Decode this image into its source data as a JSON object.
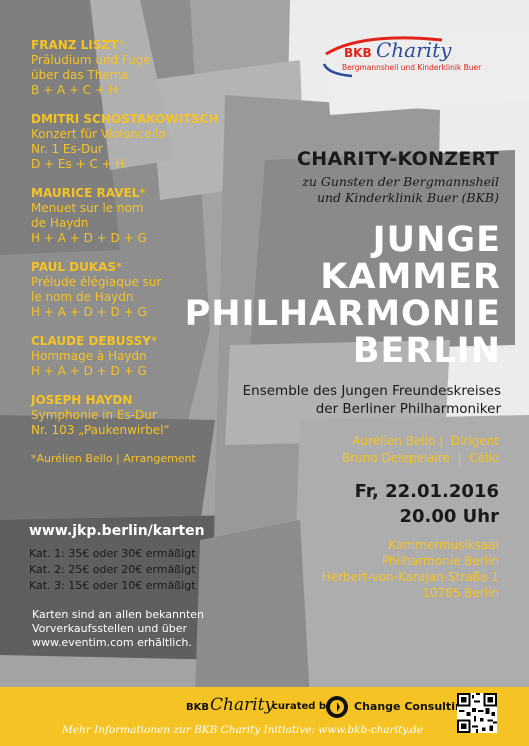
{
  "program": [
    {
      "composer": "FRANZ LISZT",
      "star": "*",
      "lines": [
        "Präludium und Fuge",
        "über das Thema",
        "B + A + C + H"
      ]
    },
    {
      "composer": "DMITRI SCHOSTAKOWITSCH",
      "star": "",
      "lines": [
        "Konzert für Violoncello",
        "Nr. 1 Es-Dur",
        "D + Es + C + H"
      ]
    },
    {
      "composer": "MAURICE RAVEL",
      "star": "*",
      "lines": [
        "Menuet sur le nom",
        "de Haydn",
        "H + A + D + D + G"
      ]
    },
    {
      "composer": "PAUL DUKAS",
      "star": "*",
      "lines": [
        "Prélude élégiaque sur",
        "le nom de Haydn",
        "H + A + D + D + G"
      ]
    },
    {
      "composer": "CLAUDE DEBUSSY",
      "star": "*",
      "lines": [
        "Hommage à Haydn",
        "H + A + D + D + G"
      ]
    },
    {
      "composer": "JOSEPH HAYDN",
      "star": "",
      "lines": [
        "Symphonie in Es-Dur",
        "Nr. 103 „Paukenwirbel“"
      ]
    }
  ],
  "arrangement_note": "*Aurélien Bello | Arrangement",
  "tickets": {
    "url": "www.jkp.berlin/karten",
    "prices": [
      "Kat. 1: 35€ oder 30€ ermäßigt",
      "Kat. 2: 25€ oder 20€ ermäßigt",
      "Kat. 3: 15€ oder 10€ ermäßigt"
    ],
    "availability": [
      "Karten sind an allen bekannten",
      "Vorverkaufsstellen und über",
      "www.eventim.com erhältlich."
    ]
  },
  "logo": {
    "brand": "BKB",
    "word": "Charity",
    "subtitle": "Bergmannsheil und Kinderklinik Buer"
  },
  "heading": {
    "kicker": "CHARITY-KONZERT",
    "subtitle": [
      "zu Gunsten der Bergmannsheil",
      "und Kinderklinik Buer (BKB)"
    ],
    "title_lines": [
      "JUNGE",
      "KAMMER",
      "PHILHARMONIE",
      "BERLIN"
    ],
    "ensemble": [
      "Ensemble des Jungen Freundeskreises",
      "der Berliner Philharmoniker"
    ]
  },
  "performers": [
    "Aurélien Bello |  Dirigent",
    "Bruno Delepelaire  |  Cello"
  ],
  "event": {
    "date": "Fr, 22.01.2016",
    "time": "20.00 Uhr",
    "venue": [
      "Kammermusiksaal",
      "Philharmonie Berlin",
      "Herbert-von-Karajan-Straße 1",
      "10785 Berlin"
    ]
  },
  "footer": {
    "brand": "BKB",
    "word": "Charity",
    "curated": "curated by",
    "partner": "Change Consulting",
    "info": "Mehr Informationen zur BKB Charity Initiative: www.bkb-charity.de"
  },
  "colors": {
    "accent": "#f6c324",
    "logo_red": "#e2231a",
    "logo_blue": "#2a4d9a"
  }
}
